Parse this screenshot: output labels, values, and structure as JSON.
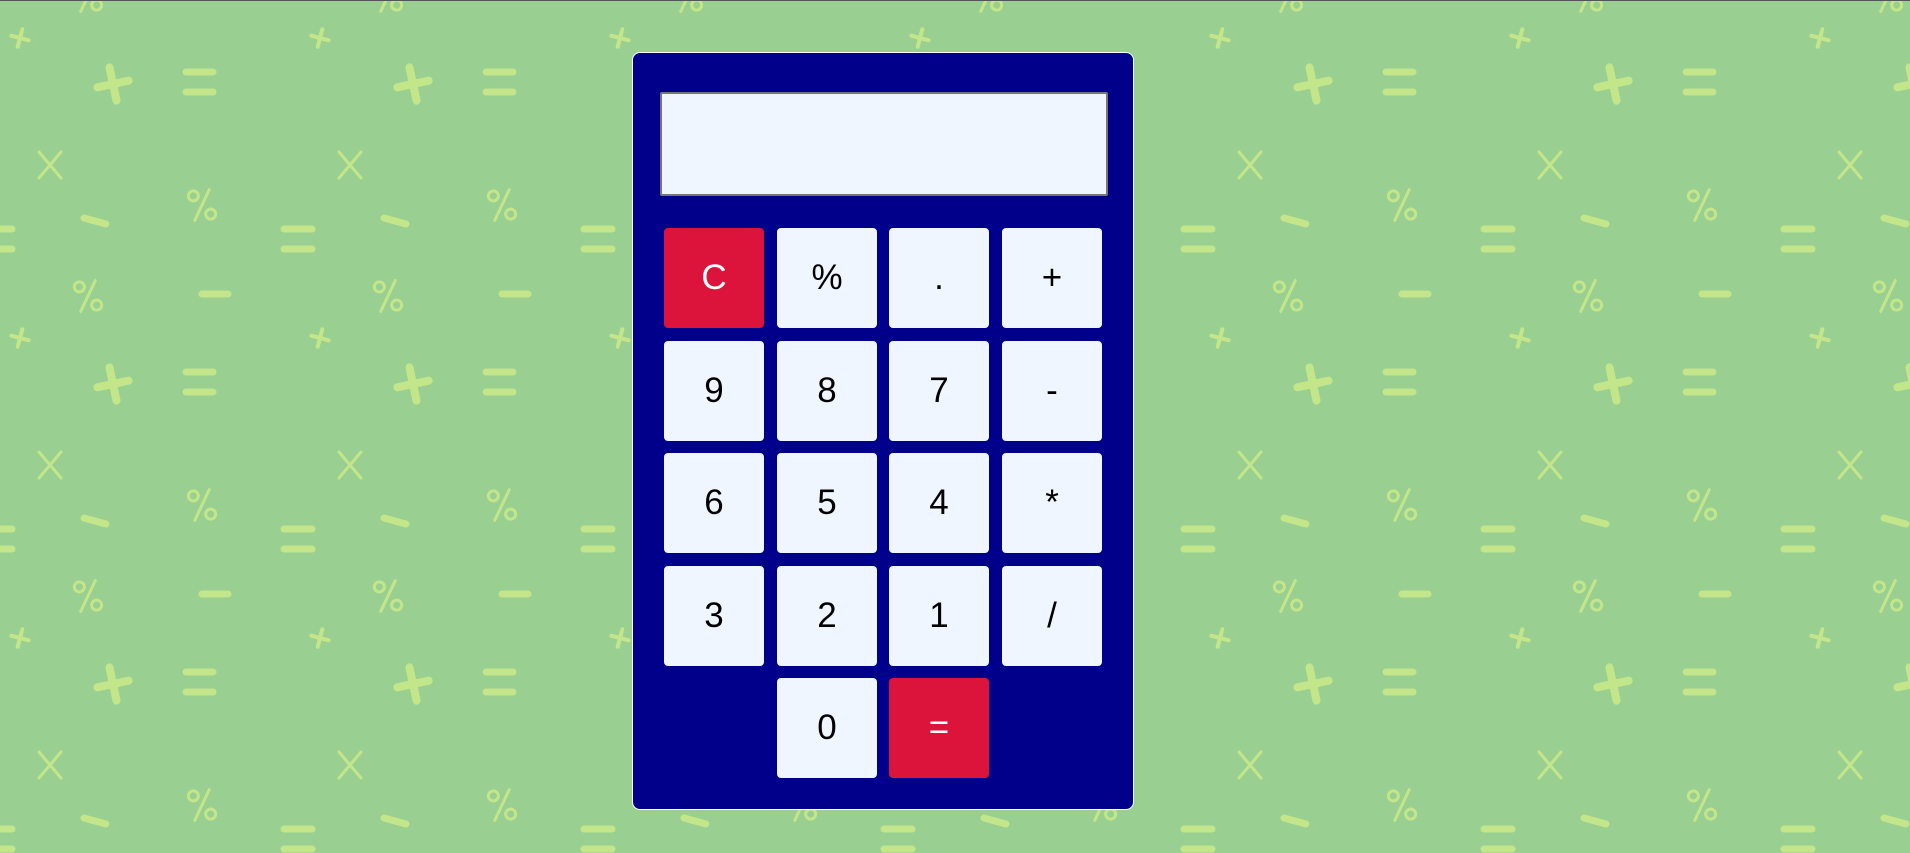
{
  "colors": {
    "background": "#99cf90",
    "pattern_symbol": "#c4e68a",
    "calculator_body": "#00008b",
    "key_face": "#eff6ff",
    "accent_key": "#dc143c"
  },
  "background_pattern": {
    "symbols": [
      "+",
      "=",
      "×",
      "−",
      "%"
    ]
  },
  "display": {
    "value": ""
  },
  "keys": {
    "clear": "C",
    "percent": "%",
    "decimal": ".",
    "plus": "+",
    "nine": "9",
    "eight": "8",
    "seven": "7",
    "minus": "-",
    "six": "6",
    "five": "5",
    "four": "4",
    "multiply": "*",
    "three": "3",
    "two": "2",
    "one": "1",
    "divide": "/",
    "zero": "0",
    "equals": "="
  }
}
